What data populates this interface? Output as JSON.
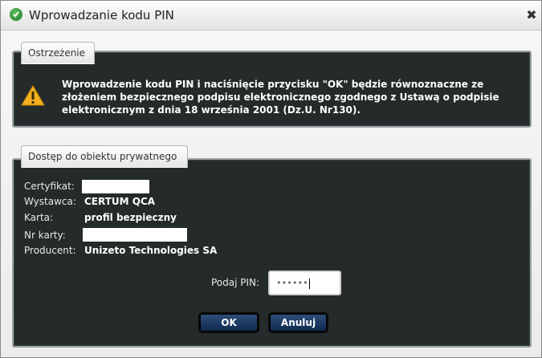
{
  "window": {
    "title": "Wprowadzanie kodu PIN",
    "close_glyph": "✖"
  },
  "warning_section": {
    "tab_label": "Ostrzeżenie",
    "icon": "warning-triangle-icon",
    "text": "Wprowadzenie kodu PIN i naciśnięcie przycisku \"OK\" będzie równoznaczne ze złożeniem bezpiecznego podpisu elektronicznego zgodnego z Ustawą o podpisie elektronicznym z dnia 18 września 2001 (Dz.U. Nr130)."
  },
  "private_object_section": {
    "tab_label": "Dostęp do obiektu prywatnego",
    "fields": [
      {
        "label": "Certyfikat:",
        "value": ""
      },
      {
        "label": "Wystawca:",
        "value": "CERTUM QCA"
      },
      {
        "label": "Karta:",
        "value": "profil bezpieczny"
      },
      {
        "label": "Nr karty:",
        "value": ""
      },
      {
        "label": "Producent:",
        "value": "Unizeto Technologies SA"
      }
    ],
    "pin_label": "Podaj PIN:",
    "pin_value": "••••••"
  },
  "buttons": {
    "ok_label": "OK",
    "cancel_label": "Anuluj"
  },
  "colors": {
    "panel_background": "#252a2b",
    "button_background": "#1a3a66",
    "accent_icon": "#2a8a35",
    "warning": "#f0b020"
  }
}
